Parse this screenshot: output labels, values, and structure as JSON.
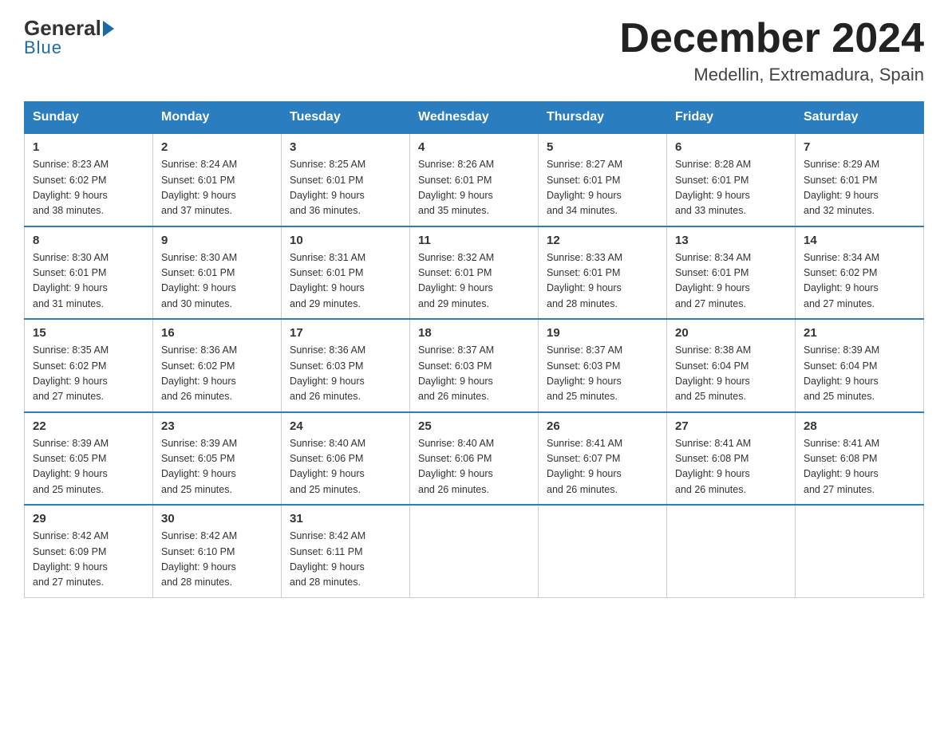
{
  "header": {
    "logo_general": "General",
    "logo_blue": "Blue",
    "month_title": "December 2024",
    "location": "Medellin, Extremadura, Spain"
  },
  "days_of_week": [
    "Sunday",
    "Monday",
    "Tuesday",
    "Wednesday",
    "Thursday",
    "Friday",
    "Saturday"
  ],
  "weeks": [
    [
      {
        "day": "1",
        "sunrise": "8:23 AM",
        "sunset": "6:02 PM",
        "daylight": "9 hours and 38 minutes."
      },
      {
        "day": "2",
        "sunrise": "8:24 AM",
        "sunset": "6:01 PM",
        "daylight": "9 hours and 37 minutes."
      },
      {
        "day": "3",
        "sunrise": "8:25 AM",
        "sunset": "6:01 PM",
        "daylight": "9 hours and 36 minutes."
      },
      {
        "day": "4",
        "sunrise": "8:26 AM",
        "sunset": "6:01 PM",
        "daylight": "9 hours and 35 minutes."
      },
      {
        "day": "5",
        "sunrise": "8:27 AM",
        "sunset": "6:01 PM",
        "daylight": "9 hours and 34 minutes."
      },
      {
        "day": "6",
        "sunrise": "8:28 AM",
        "sunset": "6:01 PM",
        "daylight": "9 hours and 33 minutes."
      },
      {
        "day": "7",
        "sunrise": "8:29 AM",
        "sunset": "6:01 PM",
        "daylight": "9 hours and 32 minutes."
      }
    ],
    [
      {
        "day": "8",
        "sunrise": "8:30 AM",
        "sunset": "6:01 PM",
        "daylight": "9 hours and 31 minutes."
      },
      {
        "day": "9",
        "sunrise": "8:30 AM",
        "sunset": "6:01 PM",
        "daylight": "9 hours and 30 minutes."
      },
      {
        "day": "10",
        "sunrise": "8:31 AM",
        "sunset": "6:01 PM",
        "daylight": "9 hours and 29 minutes."
      },
      {
        "day": "11",
        "sunrise": "8:32 AM",
        "sunset": "6:01 PM",
        "daylight": "9 hours and 29 minutes."
      },
      {
        "day": "12",
        "sunrise": "8:33 AM",
        "sunset": "6:01 PM",
        "daylight": "9 hours and 28 minutes."
      },
      {
        "day": "13",
        "sunrise": "8:34 AM",
        "sunset": "6:01 PM",
        "daylight": "9 hours and 27 minutes."
      },
      {
        "day": "14",
        "sunrise": "8:34 AM",
        "sunset": "6:02 PM",
        "daylight": "9 hours and 27 minutes."
      }
    ],
    [
      {
        "day": "15",
        "sunrise": "8:35 AM",
        "sunset": "6:02 PM",
        "daylight": "9 hours and 27 minutes."
      },
      {
        "day": "16",
        "sunrise": "8:36 AM",
        "sunset": "6:02 PM",
        "daylight": "9 hours and 26 minutes."
      },
      {
        "day": "17",
        "sunrise": "8:36 AM",
        "sunset": "6:03 PM",
        "daylight": "9 hours and 26 minutes."
      },
      {
        "day": "18",
        "sunrise": "8:37 AM",
        "sunset": "6:03 PM",
        "daylight": "9 hours and 26 minutes."
      },
      {
        "day": "19",
        "sunrise": "8:37 AM",
        "sunset": "6:03 PM",
        "daylight": "9 hours and 25 minutes."
      },
      {
        "day": "20",
        "sunrise": "8:38 AM",
        "sunset": "6:04 PM",
        "daylight": "9 hours and 25 minutes."
      },
      {
        "day": "21",
        "sunrise": "8:39 AM",
        "sunset": "6:04 PM",
        "daylight": "9 hours and 25 minutes."
      }
    ],
    [
      {
        "day": "22",
        "sunrise": "8:39 AM",
        "sunset": "6:05 PM",
        "daylight": "9 hours and 25 minutes."
      },
      {
        "day": "23",
        "sunrise": "8:39 AM",
        "sunset": "6:05 PM",
        "daylight": "9 hours and 25 minutes."
      },
      {
        "day": "24",
        "sunrise": "8:40 AM",
        "sunset": "6:06 PM",
        "daylight": "9 hours and 25 minutes."
      },
      {
        "day": "25",
        "sunrise": "8:40 AM",
        "sunset": "6:06 PM",
        "daylight": "9 hours and 26 minutes."
      },
      {
        "day": "26",
        "sunrise": "8:41 AM",
        "sunset": "6:07 PM",
        "daylight": "9 hours and 26 minutes."
      },
      {
        "day": "27",
        "sunrise": "8:41 AM",
        "sunset": "6:08 PM",
        "daylight": "9 hours and 26 minutes."
      },
      {
        "day": "28",
        "sunrise": "8:41 AM",
        "sunset": "6:08 PM",
        "daylight": "9 hours and 27 minutes."
      }
    ],
    [
      {
        "day": "29",
        "sunrise": "8:42 AM",
        "sunset": "6:09 PM",
        "daylight": "9 hours and 27 minutes."
      },
      {
        "day": "30",
        "sunrise": "8:42 AM",
        "sunset": "6:10 PM",
        "daylight": "9 hours and 28 minutes."
      },
      {
        "day": "31",
        "sunrise": "8:42 AM",
        "sunset": "6:11 PM",
        "daylight": "9 hours and 28 minutes."
      },
      null,
      null,
      null,
      null
    ]
  ],
  "labels": {
    "sunrise": "Sunrise:",
    "sunset": "Sunset:",
    "daylight": "Daylight:"
  }
}
